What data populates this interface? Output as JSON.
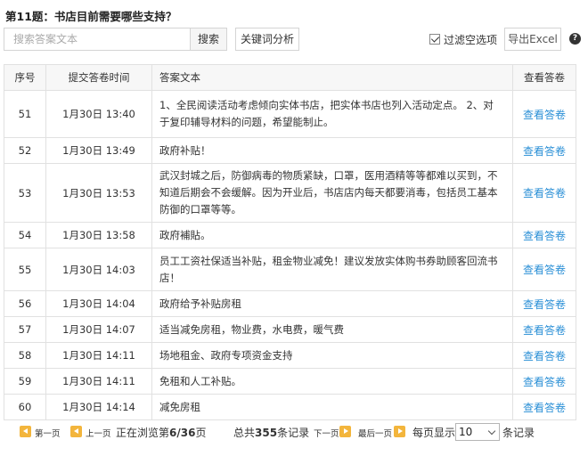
{
  "question": {
    "title": "第11题：书店目前需要哪些支持？"
  },
  "toolbar": {
    "search_placeholder": "搜索答案文本",
    "search_label": "搜索",
    "keyword_label": "关键词分析",
    "filter_label": "过滤空选项",
    "filter_checked": true,
    "export_label": "导出Excel",
    "help_icon": "?"
  },
  "table": {
    "headers": [
      "序号",
      "提交答卷时间",
      "答案文本",
      "查看答卷"
    ],
    "rows": [
      {
        "no": "51",
        "time": "1月30日 13:40",
        "text": "1、全民阅读活动考虑倾向实体书店，把实体书店也列入活动定点。 2、对于复印辅导材料的问题，希望能制止。",
        "view": "查看答卷"
      },
      {
        "no": "52",
        "time": "1月30日 13:49",
        "text": "政府补贴！",
        "view": "查看答卷"
      },
      {
        "no": "53",
        "time": "1月30日 13:53",
        "text": "武汉封城之后，防御病毒的物质紧缺，口罩，医用酒精等等都难以买到，不知道后期会不会缓解。因为开业后，书店店内每天都要消毒，包括员工基本防御的口罩等等。",
        "view": "查看答卷"
      },
      {
        "no": "54",
        "time": "1月30日 13:58",
        "text": "政府補貼。",
        "view": "查看答卷"
      },
      {
        "no": "55",
        "time": "1月30日 14:03",
        "text": "员工工资社保适当补贴，租金物业减免！建议发放实体购书券助顾客回流书店！",
        "view": "查看答卷"
      },
      {
        "no": "56",
        "time": "1月30日 14:04",
        "text": "政府给予补贴房租",
        "view": "查看答卷"
      },
      {
        "no": "57",
        "time": "1月30日 14:07",
        "text": "适当减免房租，物业费，水电费，暖气费",
        "view": "查看答卷"
      },
      {
        "no": "58",
        "time": "1月30日 14:11",
        "text": "场地租金、政府专项资金支持",
        "view": "查看答卷"
      },
      {
        "no": "59",
        "time": "1月30日 14:11",
        "text": "免租和人工补贴。",
        "view": "查看答卷"
      },
      {
        "no": "60",
        "time": "1月30日 14:14",
        "text": "减免房租",
        "view": "查看答卷"
      }
    ]
  },
  "pager": {
    "first_label": "第一页",
    "prev_label": "上一页",
    "browsing_prefix": "正在浏览第",
    "browsing_page": "6/36",
    "browsing_suffix": "页",
    "total_prefix": "总共",
    "total_count": "355",
    "total_suffix": "条记录",
    "next_label": "下一页",
    "last_label": "最后一页",
    "per_page_prefix": "每页显示",
    "per_page_value": "10",
    "per_page_suffix": "条记录"
  },
  "colors": {
    "link": "#2a8fd6",
    "pager_icon": "#f3b53c",
    "header_bg": "#f7f7f7"
  }
}
